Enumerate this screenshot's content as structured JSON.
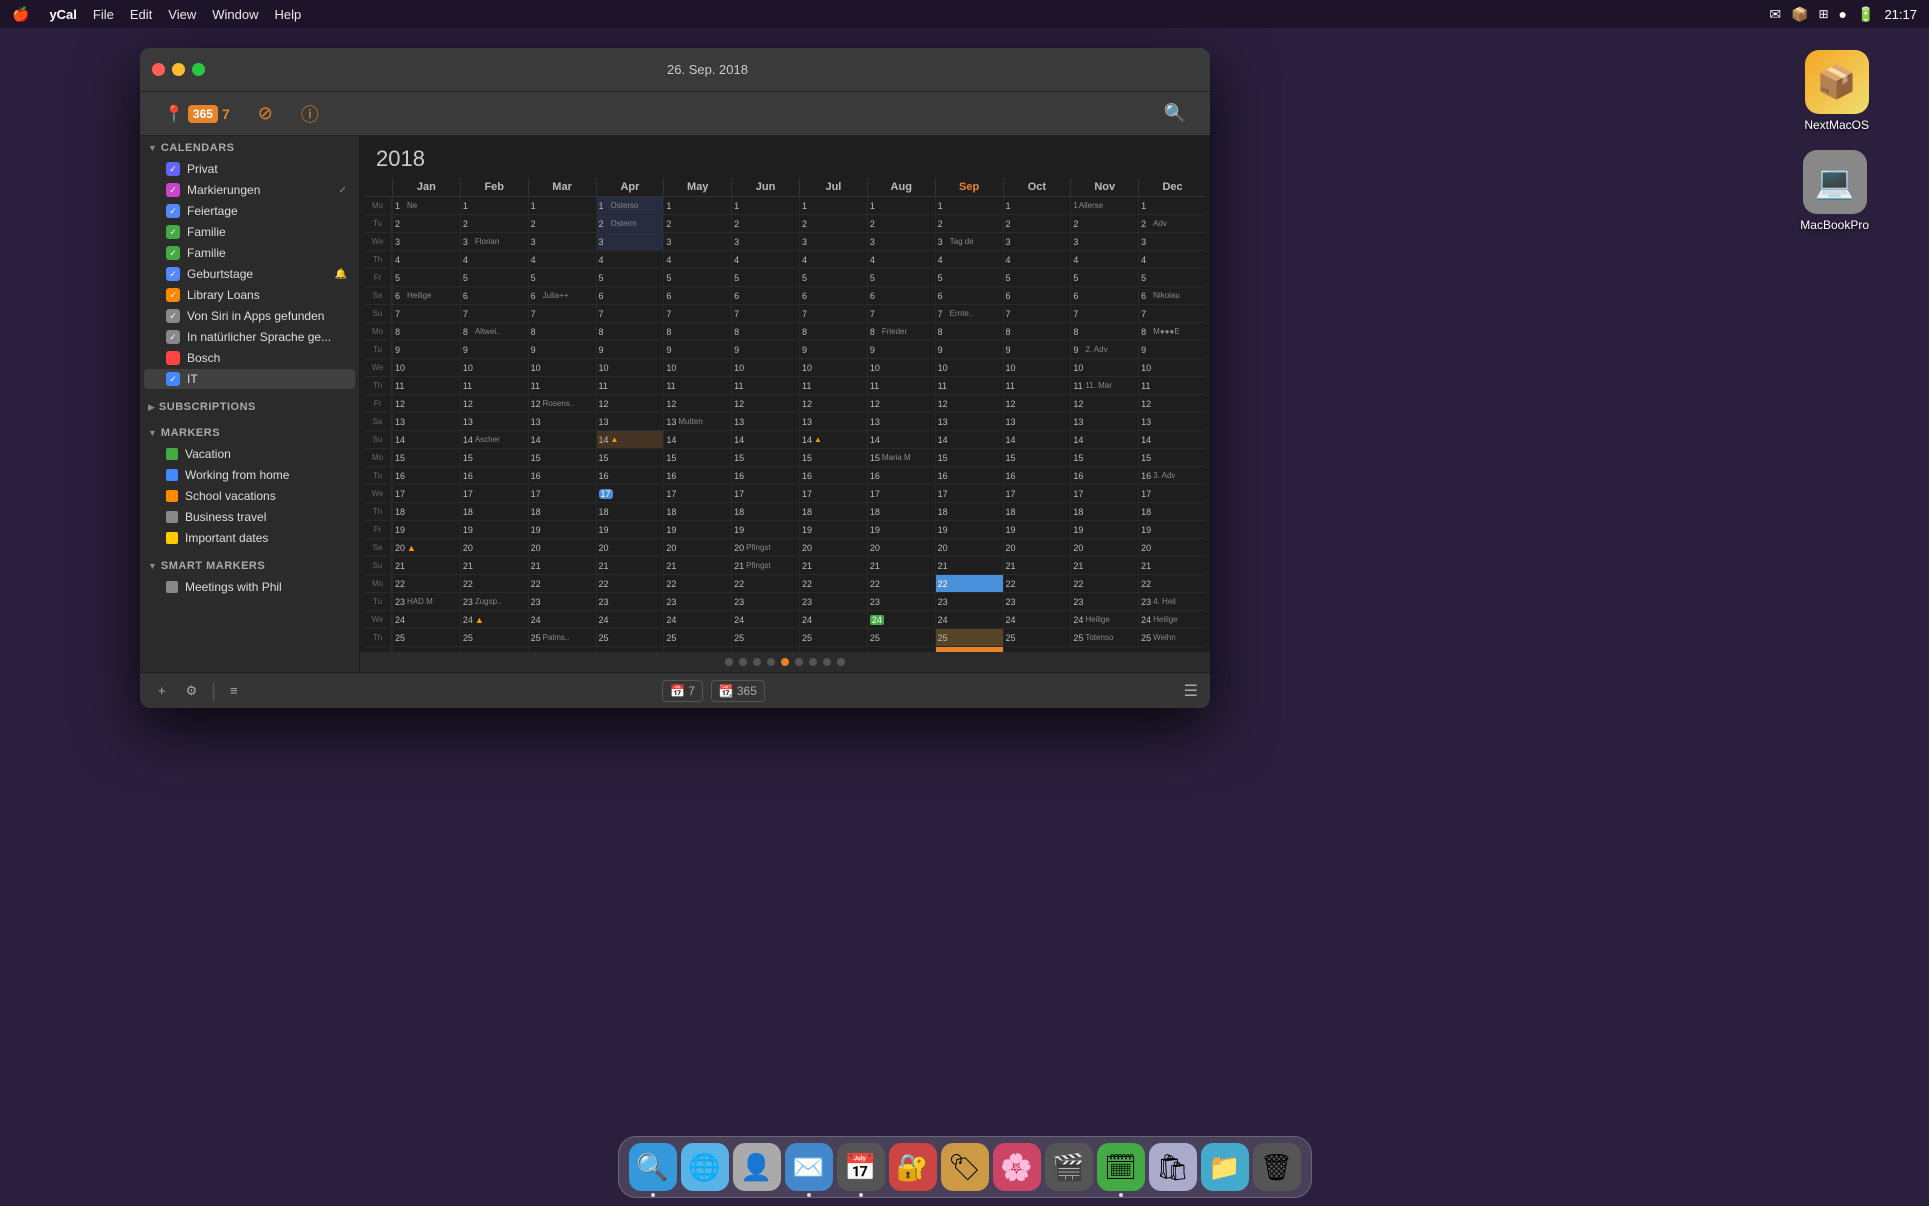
{
  "menubar": {
    "apple": "🍎",
    "app": "yCal",
    "items": [
      "File",
      "Edit",
      "View",
      "Window",
      "Help"
    ],
    "time": "21:17"
  },
  "titlebar": {
    "title": "26. Sep. 2018"
  },
  "toolbar": {
    "location_icon": "📍",
    "days_badge": "365",
    "week_badge": "7",
    "no_icon": "⊘",
    "info_icon": "ⓘ",
    "search_icon": "🔍"
  },
  "sidebar": {
    "calendars_header": "CALENDARS",
    "calendars": [
      {
        "label": "Privat",
        "color": "#6464ff",
        "checked": true
      },
      {
        "label": "Markierungen",
        "color": "#cc44cc",
        "checked": true,
        "badge": "✓"
      },
      {
        "label": "Feiertage",
        "color": "#5588ff",
        "checked": true
      },
      {
        "label": "Familie",
        "color": "#44aa44",
        "checked": true
      },
      {
        "label": "Familie",
        "color": "#44aa44",
        "checked": true
      },
      {
        "label": "Geburtstage",
        "color": "#5588ff",
        "checked": true,
        "badge": "🔔"
      },
      {
        "label": "Library Loans",
        "color": "#ff8800",
        "checked": true
      },
      {
        "label": "Von Siri in Apps gefunden",
        "color": "#888888",
        "checked": true
      },
      {
        "label": "In natürlicher Sprache ge...",
        "color": "#888888",
        "checked": true
      },
      {
        "label": "Bosch",
        "color": "#ff4444",
        "checked": false
      },
      {
        "label": "IT",
        "color": "#4488ff",
        "checked": true,
        "active": true
      }
    ],
    "subscriptions_header": "SUBSCRIPTIONS",
    "markers_header": "MARKERS",
    "markers": [
      {
        "label": "Vacation",
        "color": "#44aa44",
        "icon": "✅"
      },
      {
        "label": "Working from home",
        "color": "#4488ff",
        "icon": "✅"
      },
      {
        "label": "School vacations",
        "color": "#ff8800",
        "icon": "✅"
      },
      {
        "label": "Business travel",
        "color": "#888888",
        "icon": "✅"
      },
      {
        "label": "Important dates",
        "color": "#ffcc00",
        "icon": "✅"
      }
    ],
    "smart_markers_header": "SMART MARKERS",
    "smart_markers": [
      {
        "label": "Meetings with Phil",
        "color": "#888888",
        "icon": "✅"
      }
    ]
  },
  "calendar": {
    "year": "2018",
    "months": [
      "Jan",
      "Feb",
      "Mar",
      "Apr",
      "May",
      "Jun",
      "Jul",
      "Aug",
      "Sep",
      "Oct",
      "Nov",
      "Dec"
    ],
    "current_date": "26",
    "current_month": 8,
    "pagination_dots": 9,
    "active_dot": 4
  },
  "bottom_bar": {
    "add_label": "+",
    "settings_label": "⚙",
    "divider": "|",
    "list_icon": "≡",
    "week_view": "7",
    "year_view": "365",
    "menu_icon": "☰"
  },
  "desktop_icons": [
    {
      "label": "NextMacOS",
      "color": "#f5a623"
    },
    {
      "label": "MacBookPro",
      "color": "#888"
    }
  ],
  "dock_apps": [
    "🔍",
    "📱",
    "📸",
    "✉️",
    "📅",
    "🔖",
    "🎵",
    "🎮",
    "📊",
    "🗓️",
    "📁",
    "🗑️"
  ]
}
